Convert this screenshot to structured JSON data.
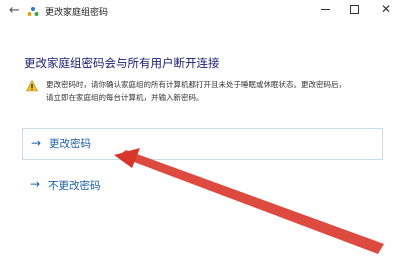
{
  "window": {
    "title": "更改家庭组密码",
    "back_icon": "back-arrow-icon",
    "app_icon": "homegroup-icon",
    "controls": [
      "minimize",
      "maximize",
      "close"
    ]
  },
  "content": {
    "heading": "更改家庭组密码会与所有用户断开连接",
    "warning_icon": "warning-icon",
    "message_line1": "更改密码时，请你确认家庭组的所有计算机都打开且未处于睡眠或休眠状态。更改密码后，",
    "message_line2": "请立即在家庭组的每台计算机，并输入新密码。"
  },
  "options": {
    "change": {
      "label": "更改密码",
      "icon": "arrow-right-icon"
    },
    "keep": {
      "label": "不更改密码",
      "icon": "arrow-right-icon"
    }
  },
  "annotation": {
    "type": "red-arrow",
    "color": "#d9362b"
  },
  "colors": {
    "link": "#1a5fa8",
    "heading": "#1a1a6e",
    "border": "#c8dbe8"
  }
}
